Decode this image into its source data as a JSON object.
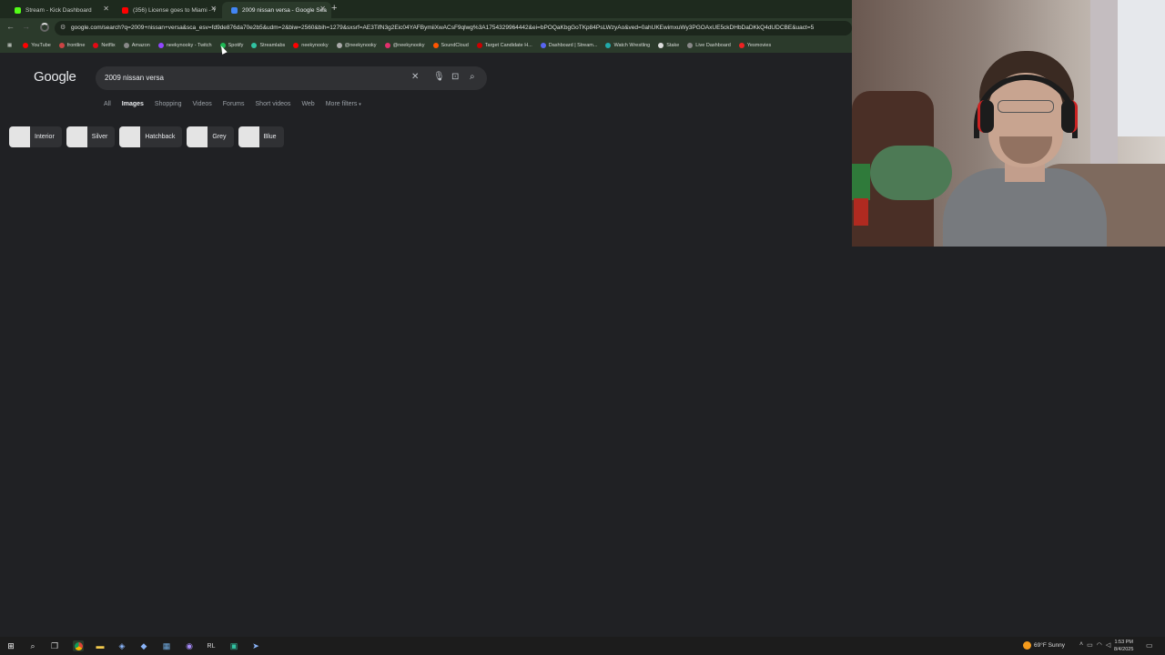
{
  "browser": {
    "tabs": [
      {
        "label": "Stream - Kick Dashboard",
        "color": "#53fc18"
      },
      {
        "label": "(356) License goes to Miami - Y",
        "color": "#ff0000"
      },
      {
        "label": "2009 nissan versa - Google Sea",
        "color": "#4285f4"
      }
    ],
    "new_tab": "+",
    "url": "google.com/search?q=2009+nissan+versa&sca_esv=fd9de876da70e2b5&udm=2&biw=2560&bih=1279&sxsrf=AE3TifN3g2Eic04YAFBymiiXwACsF9qlwg%3A1754329964442&ei=bPOQaKbgGoTKp84PsLWzyAo&ved=0ahUKEwimxuWy3PGOAxUE5ckDHbDaDKkQ4dUDCBE&uact=5",
    "bookmarks": [
      {
        "label": "YouTube",
        "color": "#ff0000"
      },
      {
        "label": "frontline",
        "color": "#c44"
      },
      {
        "label": "Netflix",
        "color": "#e50914"
      },
      {
        "label": "Amazon",
        "color": "#888"
      },
      {
        "label": "neekynooky - Twitch",
        "color": "#9146ff"
      },
      {
        "label": "Spotify",
        "color": "#1db954"
      },
      {
        "label": "Streamlabs",
        "color": "#31c3a2"
      },
      {
        "label": "neekynooky",
        "color": "#ff0000"
      },
      {
        "label": "@neekynooky",
        "color": "#aaa"
      },
      {
        "label": "@neekynooky",
        "color": "#e1306c"
      },
      {
        "label": "SoundCloud",
        "color": "#ff5500"
      },
      {
        "label": "Target Candidate H...",
        "color": "#cc0000"
      },
      {
        "label": "Dashboard | Stream...",
        "color": "#5865f2"
      },
      {
        "label": "Watch Wrestling",
        "color": "#2aa"
      },
      {
        "label": "Stake",
        "color": "#ddd"
      },
      {
        "label": "Live Dashboard",
        "color": "#888"
      },
      {
        "label": "Yesmovies",
        "color": "#e22"
      }
    ]
  },
  "google": {
    "logo": "Google",
    "query": "2009 nissan versa",
    "tabs": [
      "All",
      "Images",
      "Shopping",
      "Videos",
      "Forums",
      "Short videos",
      "Web",
      "More filters"
    ],
    "active_tab": "Images",
    "chips": [
      "Interior",
      "Silver",
      "Hatchback",
      "Grey",
      "Blue"
    ]
  },
  "taskbar": {
    "weather": "69°F  Sunny",
    "time": "1:53 PM",
    "date": "8/4/2025"
  }
}
